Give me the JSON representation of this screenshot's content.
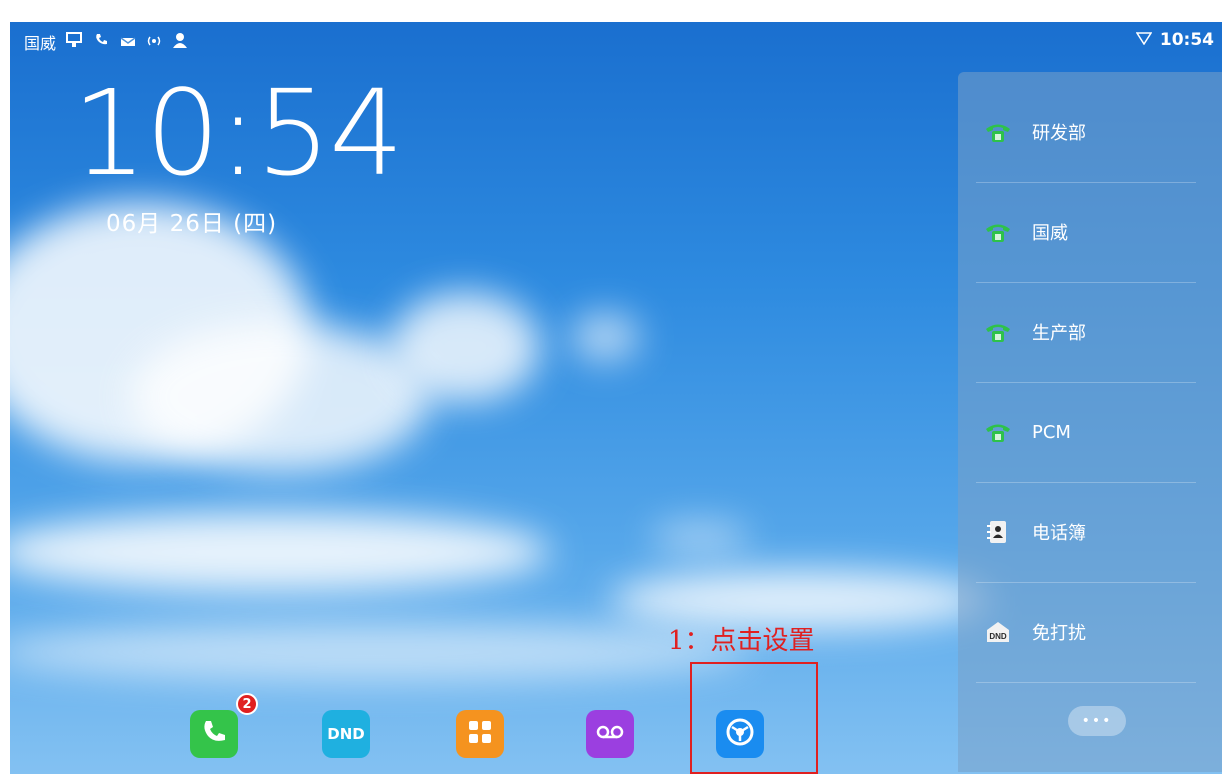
{
  "status_bar": {
    "account_name": "国威",
    "icons": [
      "desktop-icon",
      "phone-call-icon",
      "message-icon",
      "wireless-icon",
      "user-icon"
    ],
    "time": "10:54",
    "wifi_icon": "wifi-icon"
  },
  "clock": {
    "time": "10:54",
    "date": "06月 26日 (四)"
  },
  "side_panel": {
    "items": [
      {
        "label": "研发部",
        "icon": "phone-line-icon"
      },
      {
        "label": "国威",
        "icon": "phone-line-icon"
      },
      {
        "label": "生产部",
        "icon": "phone-line-icon"
      },
      {
        "label": "PCM",
        "icon": "phone-line-icon"
      },
      {
        "label": "电话簿",
        "icon": "phonebook-icon"
      },
      {
        "label": "免打扰",
        "icon": "dnd-icon"
      }
    ],
    "more_label": "•••"
  },
  "dock": {
    "items": [
      {
        "name": "phone-app",
        "label": "",
        "badge": "2",
        "color": "#34c44a"
      },
      {
        "name": "dnd-app",
        "label": "DND",
        "color": "#1fb0e0"
      },
      {
        "name": "apps-app",
        "label": "",
        "color": "#f5931f"
      },
      {
        "name": "voicemail-app",
        "label": "",
        "color": "#9b3fe0"
      },
      {
        "name": "settings-app",
        "label": "",
        "color": "#1a8cf0"
      }
    ]
  },
  "annotation": {
    "text": "1：点击设置",
    "color": "#e02020"
  }
}
